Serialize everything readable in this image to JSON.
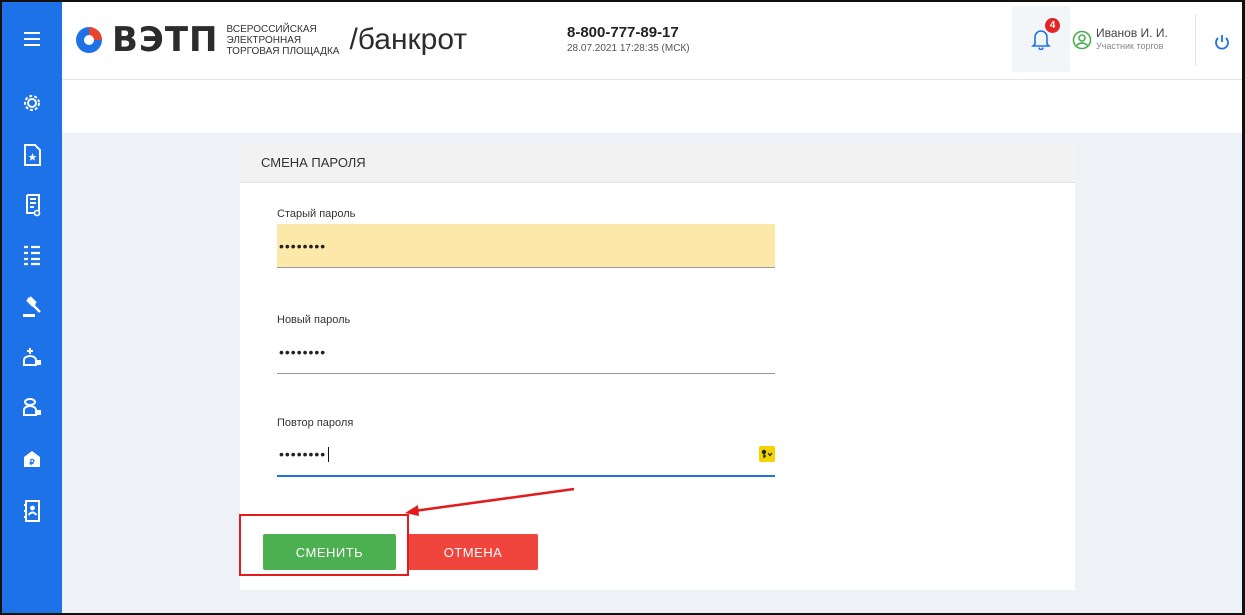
{
  "header": {
    "logo_word": "ВЭТП",
    "logo_sub": [
      "ВСЕРОССИЙСКАЯ",
      "ЭЛЕКТРОННАЯ",
      "ТОРГОВАЯ ПЛОЩАДКА"
    ],
    "section": "/банкрот",
    "phone": "8-800-777-89-17",
    "datetime": "28.07.2021 17:28:35 (МСК)",
    "notifications_count": "4",
    "user_name": "Иванов И. И.",
    "user_role": "Участник торгов"
  },
  "sidebar": {
    "icons": [
      "menu-icon",
      "gear-icon",
      "document-star-icon",
      "scroll-icon",
      "list-icon",
      "gavel-icon",
      "add-lot-icon",
      "lot-icon",
      "wallet-icon",
      "contacts-icon"
    ]
  },
  "form": {
    "title": "СМЕНА ПАРОЛЯ",
    "old_password_label": "Старый пароль",
    "old_password_value": "••••••••",
    "new_password_label": "Новый пароль",
    "new_password_value": "••••••••",
    "repeat_password_label": "Повтор пароля",
    "repeat_password_value": "••••••••",
    "submit_label": "СМЕНИТЬ",
    "cancel_label": "ОТМЕНА"
  },
  "colors": {
    "sidebar": "#1d72e8",
    "submit": "#4caf50",
    "cancel": "#f0453c",
    "highlight": "#e31b1b",
    "autofill": "#fce8a8"
  }
}
